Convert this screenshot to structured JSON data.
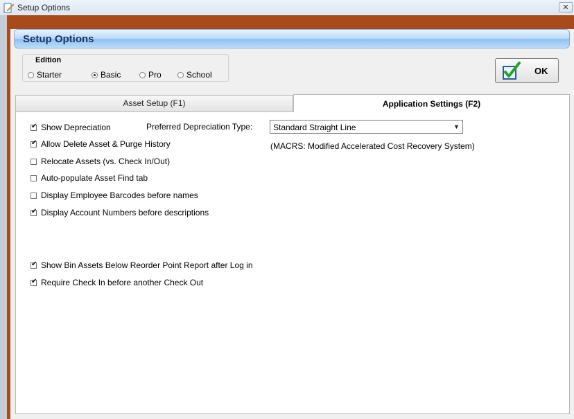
{
  "window": {
    "title": "Setup Options",
    "close_glyph": "✕"
  },
  "header": {
    "title": "Setup Options"
  },
  "edition": {
    "label": "Edition",
    "options": [
      {
        "label": "Starter",
        "selected": false
      },
      {
        "label": "Basic",
        "selected": true
      },
      {
        "label": "Pro",
        "selected": false
      },
      {
        "label": "School",
        "selected": false
      }
    ]
  },
  "ok_button": {
    "label": "OK",
    "icon": "check-icon"
  },
  "tabs": [
    {
      "label": "Asset Setup (F1)",
      "active": false
    },
    {
      "label": "Application Settings (F2)",
      "active": true
    }
  ],
  "settings": {
    "options": [
      {
        "label": "Show Depreciation",
        "checked": true
      },
      {
        "label": "Allow Delete Asset & Purge History",
        "checked": true
      },
      {
        "label": "Relocate Assets (vs. Check In/Out)",
        "checked": false
      },
      {
        "label": "Auto-populate Asset Find tab",
        "checked": false
      },
      {
        "label": "Display Employee Barcodes before names",
        "checked": false
      },
      {
        "label": "Display Account Numbers before descriptions",
        "checked": true
      },
      {
        "label": "Show Bin Assets Below Reorder Point Report after Log in",
        "checked": true
      },
      {
        "label": "Require Check In before another Check Out",
        "checked": true
      }
    ],
    "depreciation_label": "Preferred Depreciation Type:",
    "depreciation_value": "Standard Straight Line",
    "depreciation_note": "(MACRS:  Modified Accelerated Cost Recovery System)"
  },
  "colors": {
    "accent": "#8fc0ef",
    "frame": "#a84b1c",
    "check": "#2aa02a"
  }
}
